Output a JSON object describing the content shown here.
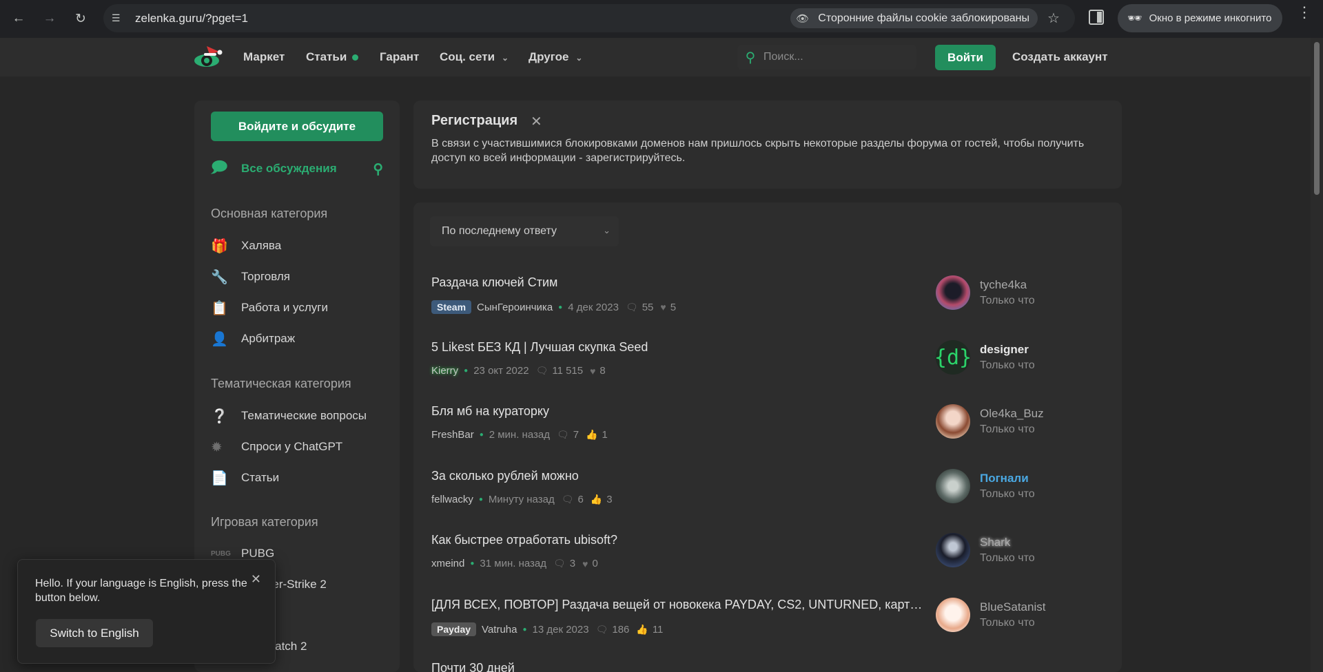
{
  "browser": {
    "url": "zelenka.guru/?pget=1",
    "cookie_notice": "Сторонние файлы cookie заблокированы",
    "incognito_label": "Окно в режиме инкогнито"
  },
  "header": {
    "nav": [
      "Маркет",
      "Статьи",
      "Гарант",
      "Соц. сети",
      "Другое"
    ],
    "search_placeholder": "Поиск...",
    "login": "Войти",
    "create_account": "Создать аккаунт"
  },
  "sidebar": {
    "discuss_button": "Войдите и обсудите",
    "all_discussions": "Все обсуждения",
    "main_category": "Основная категория",
    "main_items": [
      "Халява",
      "Торговля",
      "Работа и услуги",
      "Арбитраж"
    ],
    "thematic_category": "Тематическая категория",
    "thematic_items": [
      "Тематические вопросы",
      "Спроси у ChatGPT",
      "Статьи"
    ],
    "gaming_category": "Игровая категория",
    "gaming_items": [
      "PUBG",
      "Counter-Strike 2",
      "Overwatch 2"
    ]
  },
  "registration": {
    "title": "Регистрация",
    "text": "В связи с участившимися блокировками доменов нам пришлось скрыть некоторые разделы форума от гостей, чтобы получить доступ ко всей информации - зарегистрируйтесь."
  },
  "sort_label": "По последнему ответу",
  "threads": [
    {
      "title": "Раздача ключей Стим",
      "tag": "Steam",
      "author": "СынГероинчика",
      "date": "4 дек 2023",
      "replies": "55",
      "likes": "5",
      "user": "tyche4ka",
      "time": "Только что"
    },
    {
      "title": "5 Likest БЕЗ КД | Лучшая скупка Seed",
      "tag": "",
      "author": "Kierry",
      "date": "23 окт 2022",
      "replies": "11 515",
      "likes": "8",
      "user": "designer",
      "time": "Только что"
    },
    {
      "title": "Бля мб на кураторку",
      "tag": "",
      "author": "FreshBar",
      "date": "2 мин. назад",
      "replies": "7",
      "likes": "1",
      "user": "Ole4ka_Buz",
      "time": "Только что"
    },
    {
      "title": "За сколько рублей можно",
      "tag": "",
      "author": "fellwacky",
      "date": "Минуту назад",
      "replies": "6",
      "likes": "3",
      "user": "Погнали",
      "time": "Только что"
    },
    {
      "title": "Как быстрее отработать ubisoft?",
      "tag": "",
      "author": "xmeind",
      "date": "31 мин. назад",
      "replies": "3",
      "likes": "0",
      "user": "Shark",
      "time": "Только что"
    },
    {
      "title": "[ДЛЯ ВСЕХ, ПОВТОР] Раздача вещей от новокека PAYDAY, CS2, UNTURNED, карт…",
      "tag": "Payday",
      "author": "Vatruha",
      "date": "13 дек 2023",
      "replies": "186",
      "likes": "11",
      "user": "BlueSatanist",
      "time": "Только что"
    },
    {
      "title": "Почти 30 дней",
      "tag": "",
      "author": "",
      "date": "",
      "replies": "",
      "likes": "",
      "user": "",
      "time": ""
    }
  ],
  "toast": {
    "text": "Hello. If your language is English, press the button below.",
    "button": "Switch to English"
  }
}
